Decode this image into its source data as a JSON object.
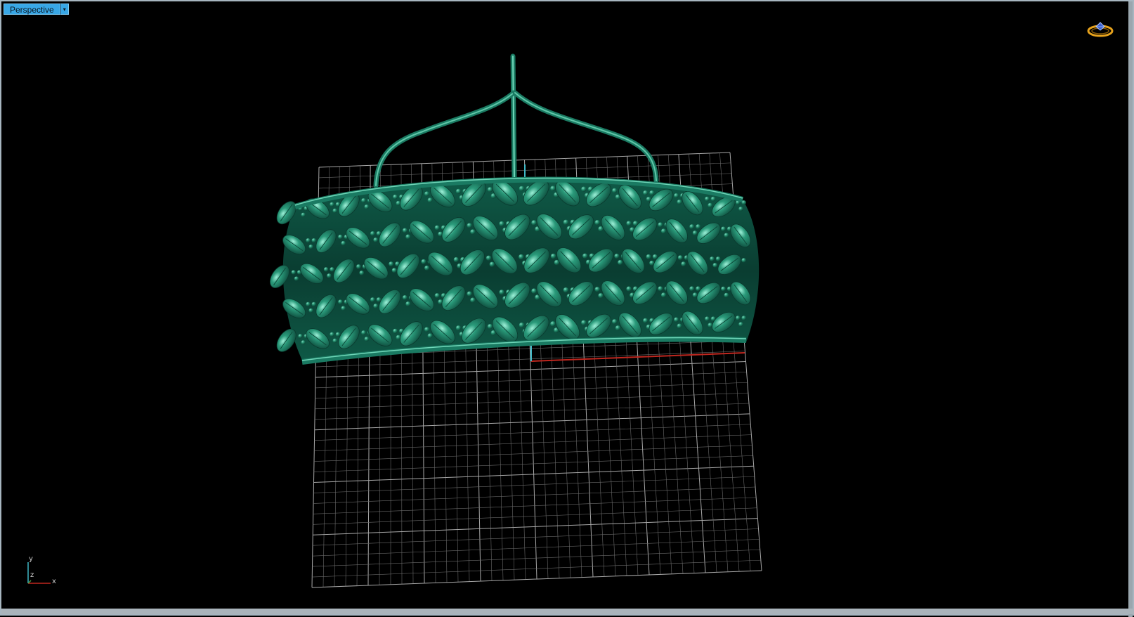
{
  "viewport": {
    "title": "Perspective",
    "menu_arrow": "▾"
  },
  "axes": {
    "y_label": "y",
    "z_label": "z",
    "x_label": "x"
  },
  "colors": {
    "model": "#1a7a62",
    "model_highlight": "#9ef0d8",
    "grid": "#8c8c8c",
    "x_axis": "#c0271f",
    "y_axis": "#3fb8c6",
    "title_bar": "#38a7e6"
  },
  "icons": {
    "viewport_menu": "chevron-down-icon",
    "ring_logo": "ring-icon",
    "axis_gizmo": "axis-gizmo-icon"
  }
}
